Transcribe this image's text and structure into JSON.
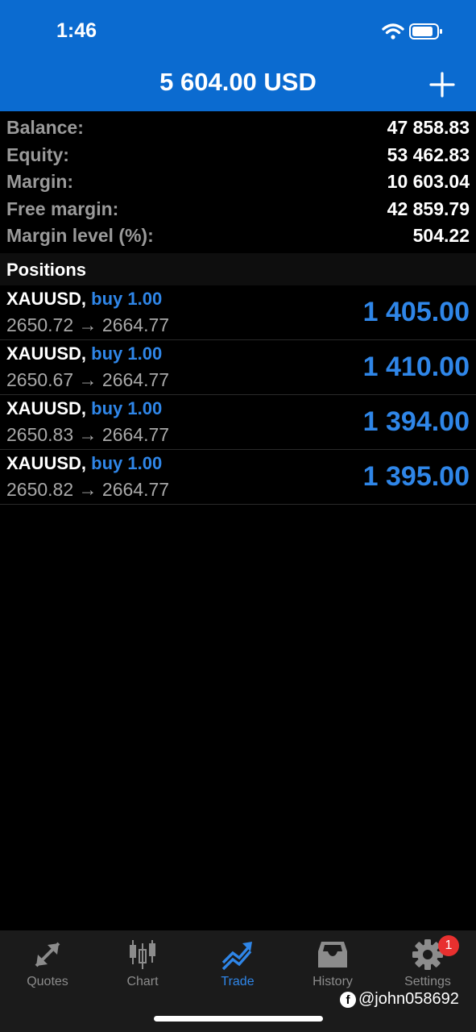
{
  "status_bar": {
    "time": "1:46"
  },
  "header": {
    "title": "5 604.00 USD",
    "add_icon": "plus-icon"
  },
  "summary": [
    {
      "label": "Balance:",
      "value": "47 858.83"
    },
    {
      "label": "Equity:",
      "value": "53 462.83"
    },
    {
      "label": "Margin:",
      "value": "10 603.04"
    },
    {
      "label": "Free margin:",
      "value": "42 859.79"
    },
    {
      "label": "Margin level (%):",
      "value": "504.22"
    }
  ],
  "positions_header": "Positions",
  "positions": [
    {
      "symbol": "XAUUSD,",
      "type": "buy 1.00",
      "prices": "2650.72 → 2664.77",
      "profit": "1 405.00"
    },
    {
      "symbol": "XAUUSD,",
      "type": "buy 1.00",
      "prices": "2650.67 → 2664.77",
      "profit": "1 410.00"
    },
    {
      "symbol": "XAUUSD,",
      "type": "buy 1.00",
      "prices": "2650.83 → 2664.77",
      "profit": "1 394.00"
    },
    {
      "symbol": "XAUUSD,",
      "type": "buy 1.00",
      "prices": "2650.82 → 2664.77",
      "profit": "1 395.00"
    }
  ],
  "tabs": [
    {
      "label": "Quotes",
      "icon": "quotes-arrows-icon",
      "active": false
    },
    {
      "label": "Chart",
      "icon": "candlestick-chart-icon",
      "active": false
    },
    {
      "label": "Trade",
      "icon": "trade-trend-icon",
      "active": true
    },
    {
      "label": "History",
      "icon": "history-inbox-icon",
      "active": false
    },
    {
      "label": "Settings",
      "icon": "gear-icon",
      "active": false
    }
  ],
  "settings_badge": "1",
  "watermark": "@john058692",
  "colors": {
    "header": "#0b6bd0",
    "accent": "#2f86e8",
    "badge": "#e8302f"
  }
}
